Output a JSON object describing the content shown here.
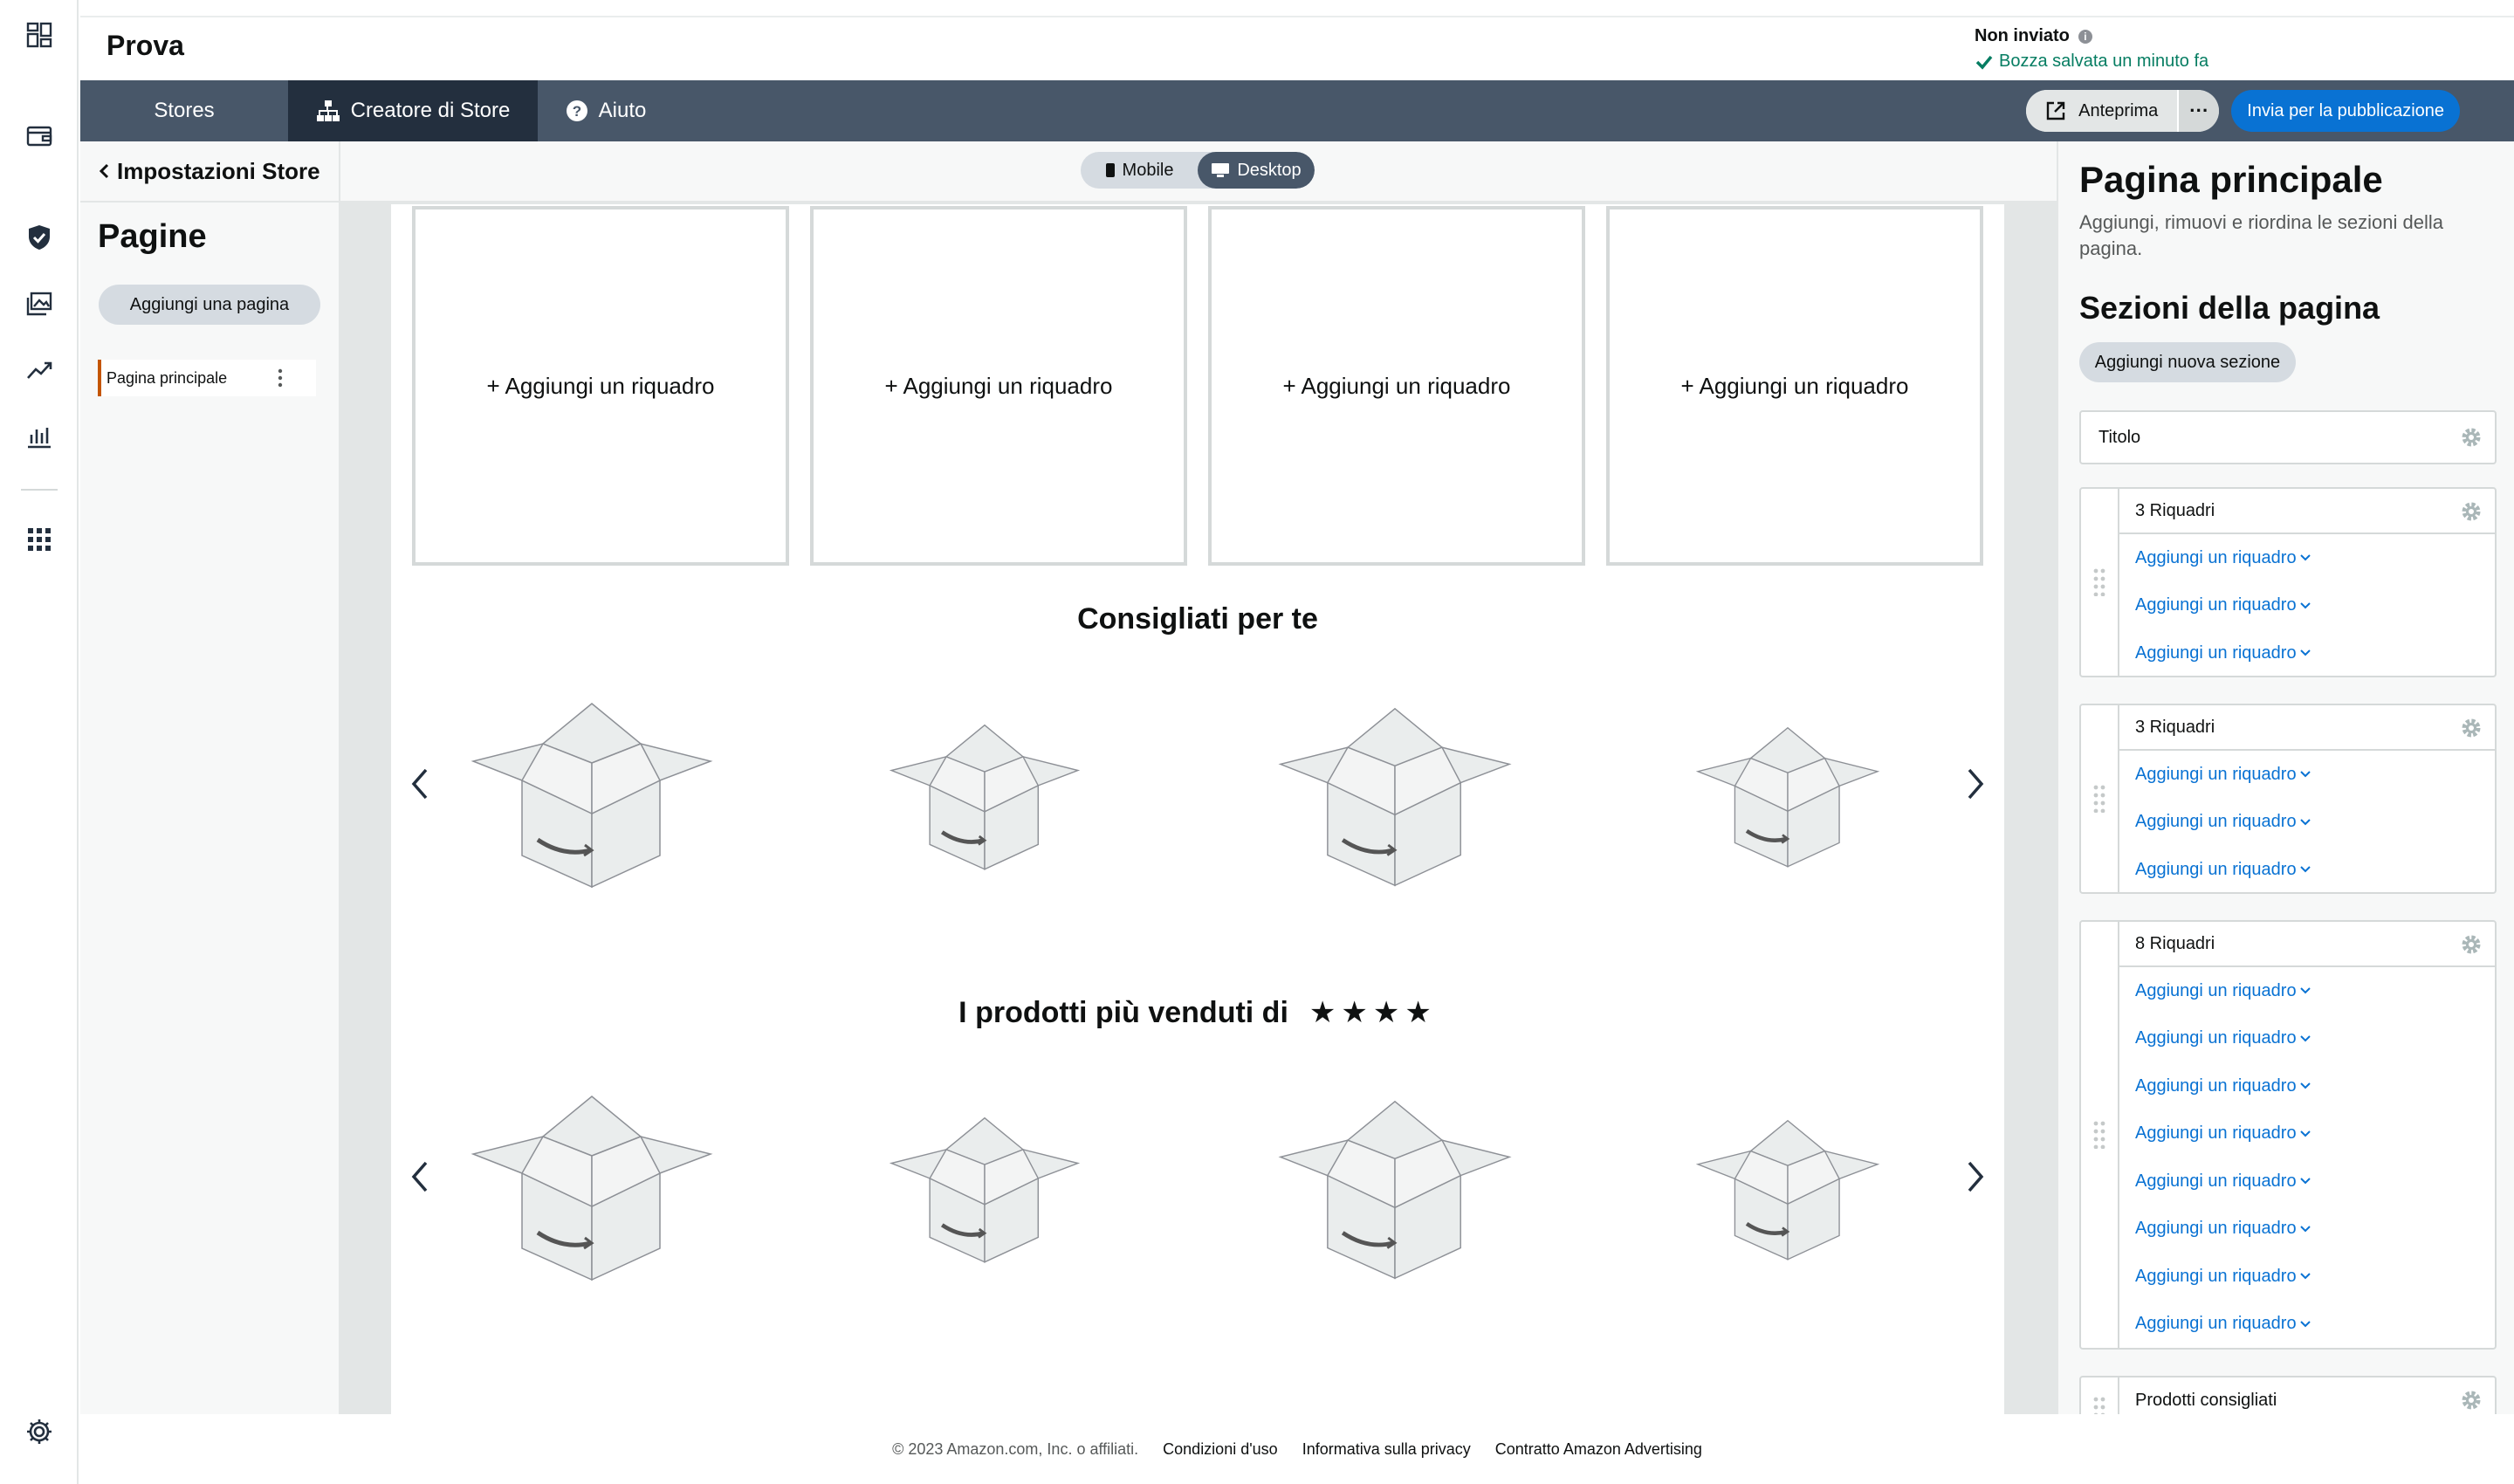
{
  "app": {
    "title": "Prova"
  },
  "status": {
    "title": "Non inviato",
    "saved": "Bozza salvata un minuto fa"
  },
  "rail": {
    "icons": [
      "dashboard-icon",
      "wallet-icon",
      "shield-icon",
      "gallery-icon",
      "trend-icon",
      "bar-chart-icon",
      "apps-icon",
      "settings-icon"
    ]
  },
  "nav": {
    "tabs": [
      {
        "label": "Stores",
        "icon": ""
      },
      {
        "label": "Creatore di Store",
        "icon": "sitemap-icon"
      },
      {
        "label": "Aiuto",
        "icon": "help-icon"
      }
    ],
    "active": "Creatore di Store",
    "preview": "Anteprima",
    "more": "···",
    "publish": "Invia per la pubblicazione"
  },
  "left": {
    "back": "Impostazioni Store",
    "title": "Pagine",
    "add_page": "Aggiungi una pagina",
    "pages": [
      "Pagina principale"
    ]
  },
  "canvas": {
    "toggle": {
      "mobile": "Mobile",
      "desktop": "Desktop",
      "active": "Desktop"
    },
    "tiles": [
      "+ Aggiungi un riquadro",
      "+ Aggiungi un riquadro",
      "+ Aggiungi un riquadro",
      "+ Aggiungi un riquadro"
    ],
    "recommended_heading": "Consigliati per te",
    "bestsellers_heading": "I prodotti più venduti di",
    "bestsellers_brand": "★★★★"
  },
  "right": {
    "title": "Pagina principale",
    "description": "Aggiungi, rimuovi e riordina le sezioni della pagina.",
    "sections_title": "Sezioni della pagina",
    "add_section": "Aggiungi nuova sezione",
    "cards": [
      {
        "title": "Titolo",
        "links": []
      },
      {
        "title": "3 Riquadri",
        "links": [
          "Aggiungi un riquadro",
          "Aggiungi un riquadro",
          "Aggiungi un riquadro"
        ]
      },
      {
        "title": "3 Riquadri",
        "links": [
          "Aggiungi un riquadro",
          "Aggiungi un riquadro",
          "Aggiungi un riquadro"
        ]
      },
      {
        "title": "8 Riquadri",
        "links": [
          "Aggiungi un riquadro",
          "Aggiungi un riquadro",
          "Aggiungi un riquadro",
          "Aggiungi un riquadro",
          "Aggiungi un riquadro",
          "Aggiungi un riquadro",
          "Aggiungi un riquadro",
          "Aggiungi un riquadro"
        ]
      },
      {
        "title": "Prodotti consigliati",
        "links": []
      }
    ]
  },
  "footer": {
    "copyright": "© 2023 Amazon.com, Inc. o affiliati.",
    "links": [
      "Condizioni d'uso",
      "Informativa sulla privacy",
      "Contratto Amazon Advertising"
    ]
  },
  "colors": {
    "nav": "#485769",
    "nav_active": "#232f3e",
    "link": "#0972d3",
    "success": "#067d62",
    "accent": "#c45500"
  }
}
